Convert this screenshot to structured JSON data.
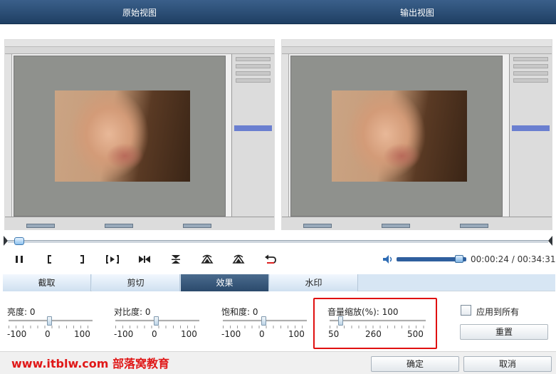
{
  "header": {
    "original_label": "原始视图",
    "output_label": "输出视图"
  },
  "player": {
    "time": "00:00:24 / 00:34:31",
    "timeline_progress": 0.012,
    "volume_level": 0.95,
    "buttons": [
      {
        "name": "pause-button",
        "glyph": "⏸"
      },
      {
        "name": "mark-in-button",
        "glyph": "["
      },
      {
        "name": "mark-out-button",
        "glyph": "]"
      },
      {
        "name": "play-selection-button",
        "glyph": "[▸]"
      },
      {
        "name": "step-button",
        "glyph": "▸|◂"
      },
      {
        "name": "flip-vertical-button",
        "glyph": "⧗"
      },
      {
        "name": "rotate-left-button",
        "glyph": "⟲"
      },
      {
        "name": "rotate-right-button",
        "glyph": "⟳"
      },
      {
        "name": "undo-button",
        "glyph": "↶"
      }
    ]
  },
  "tabs": [
    {
      "label": "截取",
      "active": false
    },
    {
      "label": "剪切",
      "active": false
    },
    {
      "label": "效果",
      "active": true
    },
    {
      "label": "水印",
      "active": false
    }
  ],
  "effects": {
    "brightness": {
      "label": "亮度:",
      "value": "0",
      "min": "-100",
      "mid": "0",
      "max": "100"
    },
    "contrast": {
      "label": "对比度:",
      "value": "0",
      "min": "-100",
      "mid": "0",
      "max": "100"
    },
    "saturation": {
      "label": "饱和度:",
      "value": "0",
      "min": "-100",
      "mid": "0",
      "max": "100"
    },
    "volume_scale": {
      "label": "音量缩放(%):",
      "value": "100",
      "min": "50",
      "mid": "260",
      "max": "500"
    }
  },
  "apply_all_label": "应用到所有",
  "reset_label": "重置",
  "watermark": "www.itblw.com  部落窝教育",
  "ok_label": "确定",
  "cancel_label": "取消"
}
